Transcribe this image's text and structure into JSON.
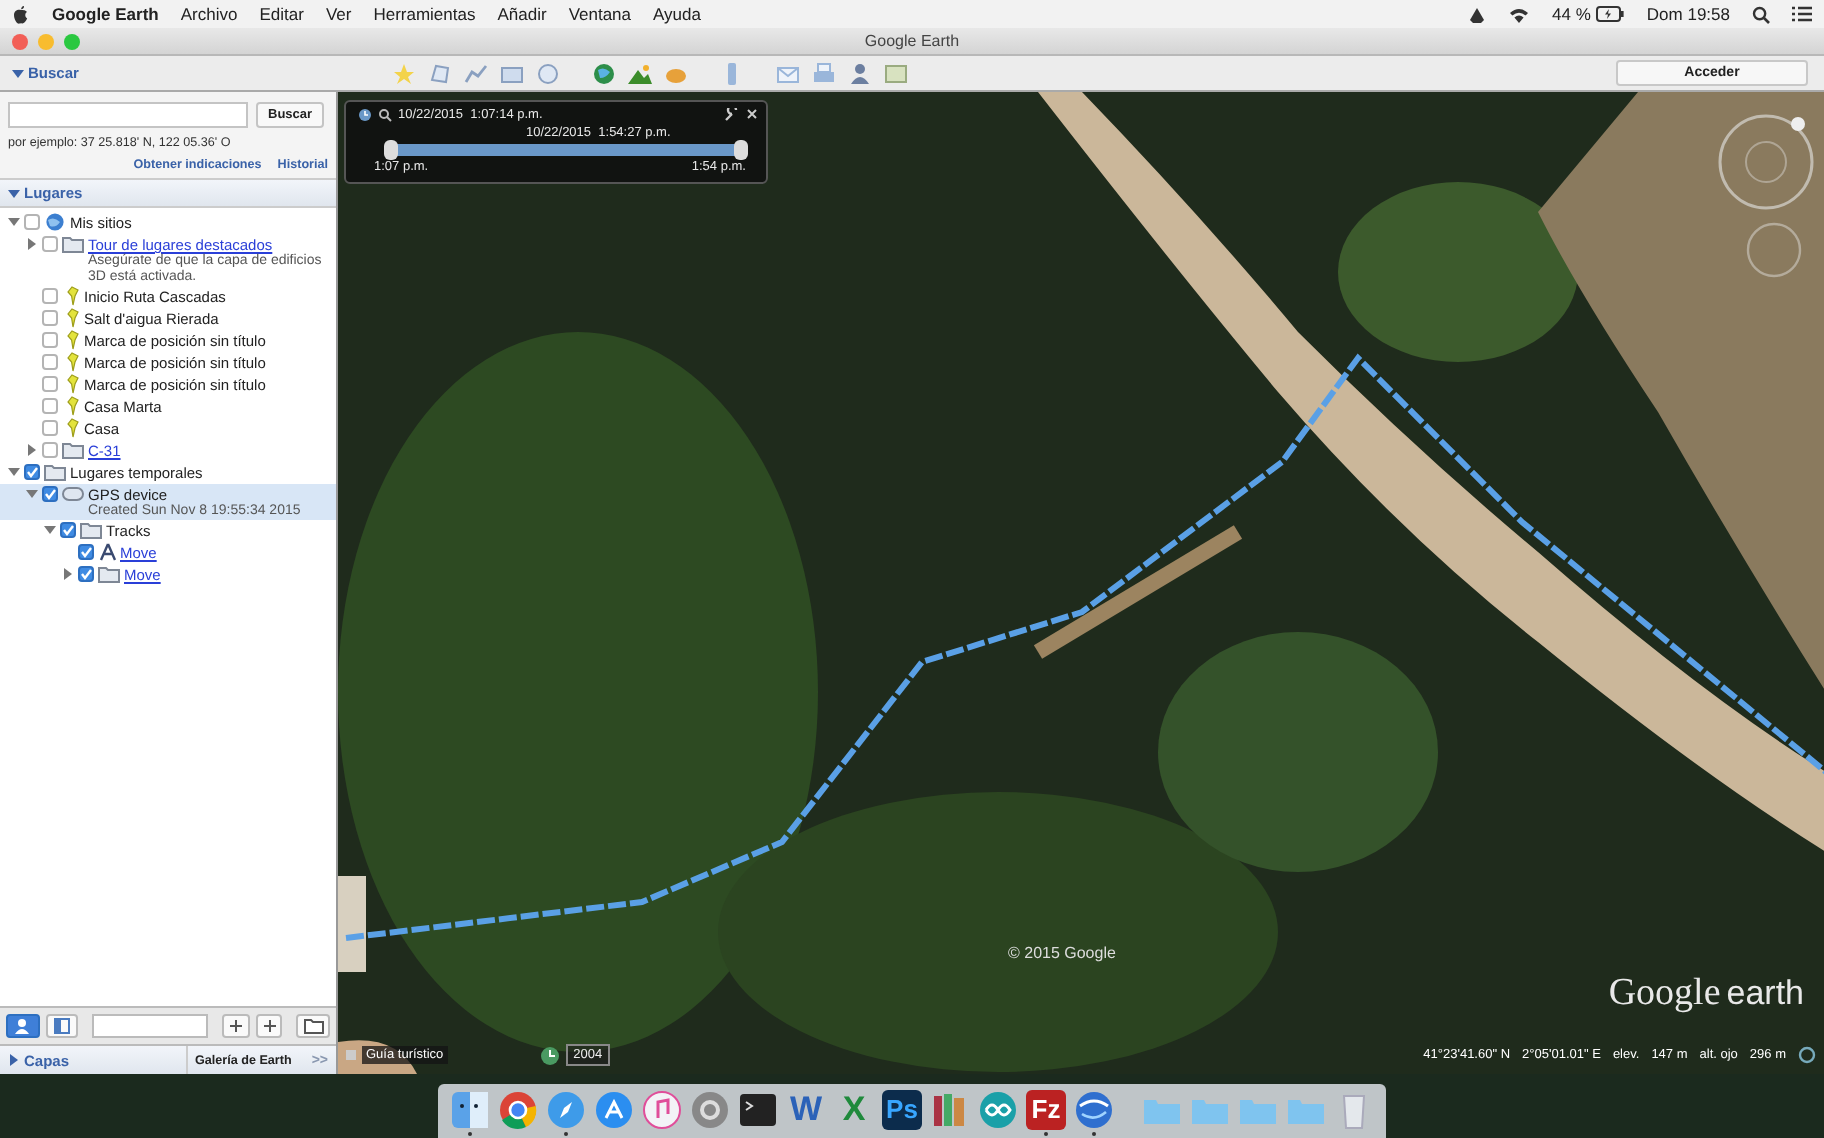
{
  "menu_bar": {
    "app": "Google Earth",
    "items": [
      "Archivo",
      "Editar",
      "Ver",
      "Herramientas",
      "Añadir",
      "Ventana",
      "Ayuda"
    ],
    "battery": "44 %",
    "clock": "Dom 19:58"
  },
  "window": {
    "title": "Google Earth",
    "sign_in": "Acceder"
  },
  "search": {
    "title": "Buscar",
    "expanded": true,
    "button": "Buscar",
    "hint": "por ejemplo: 37 25.818' N, 122 05.36' O",
    "links": [
      "Obtener indicaciones",
      "Historial"
    ]
  },
  "places": {
    "title": "Lugares",
    "expanded": true,
    "items": [
      {
        "label": "Mis sitios",
        "kind": "globe",
        "checked": false,
        "expanded": true,
        "selected": false,
        "children": [
          {
            "label": "Tour de lugares destacados",
            "kind": "folder",
            "link": true,
            "note": "Asegúrate de que la capa de edificios 3D está activada.",
            "checked": false,
            "expanded": false,
            "selected": false
          },
          {
            "label": "Inicio Ruta Cascadas",
            "kind": "pin",
            "checked": false,
            "selected": false
          },
          {
            "label": "Salt d'aigua Rierada",
            "kind": "pin",
            "checked": false,
            "selected": false
          },
          {
            "label": "Marca de posición sin título",
            "kind": "pin",
            "checked": false,
            "selected": false
          },
          {
            "label": "Marca de posición sin título",
            "kind": "pin",
            "checked": false,
            "selected": false
          },
          {
            "label": "Marca de posición sin título",
            "kind": "pin",
            "checked": false,
            "selected": false
          },
          {
            "label": "Casa Marta",
            "kind": "pin",
            "checked": false,
            "selected": false
          },
          {
            "label": "Casa",
            "kind": "pin",
            "checked": false,
            "selected": false
          },
          {
            "label": "C-31",
            "kind": "folder",
            "link": true,
            "checked": false,
            "expanded": false,
            "selected": false
          }
        ]
      },
      {
        "label": "Lugares temporales",
        "kind": "folder",
        "checked": true,
        "expanded": true,
        "selected": false,
        "children": [
          {
            "label": "GPS device",
            "kind": "gps",
            "note": "Created Sun Nov 8 19:55:34 2015",
            "checked": true,
            "expanded": true,
            "selected": true,
            "children": [
              {
                "label": "Tracks",
                "kind": "folder",
                "checked": true,
                "expanded": true,
                "selected": false,
                "children": [
                  {
                    "label": "Move",
                    "kind": "track",
                    "link": true,
                    "checked": true,
                    "selected": false
                  },
                  {
                    "label": "Move",
                    "kind": "folder",
                    "link": true,
                    "checked": true,
                    "expanded": false,
                    "selected": false
                  }
                ]
              }
            ]
          }
        ]
      }
    ]
  },
  "layers": {
    "title": "Capas",
    "expanded": false,
    "gallery": "Galería de Earth",
    "more": ">>"
  },
  "time_slider": {
    "start": "10/22/2015  1:07:14 p.m.",
    "end": "10/22/2015  1:54:27 p.m.",
    "min_label": "1:07 p.m.",
    "max_label": "1:54 p.m."
  },
  "map": {
    "copyright": "© 2015 Google",
    "logo_word_1": "Google",
    "logo_word_2": "earth"
  },
  "status_bar": {
    "tour_guide": "Guía turístico",
    "imagery_year": "2004",
    "latitude": "41°23'41.60\" N",
    "longitude": "2°05'01.01\" E",
    "elev_label": "elev.",
    "elev": "147 m",
    "eye_label": "alt. ojo",
    "eye": "296 m"
  },
  "dock": [
    {
      "kind": "finder",
      "running": true
    },
    {
      "kind": "chrome",
      "running": false
    },
    {
      "kind": "safari",
      "running": true
    },
    {
      "kind": "appstore",
      "running": false
    },
    {
      "kind": "itunes",
      "running": false
    },
    {
      "kind": "prefs",
      "running": false
    },
    {
      "kind": "terminal",
      "running": false
    },
    {
      "kind": "letter",
      "glyph": "W",
      "running": false
    },
    {
      "kind": "letter",
      "glyph": "X",
      "running": false
    },
    {
      "kind": "letter",
      "glyph": "Ps",
      "running": false
    },
    {
      "kind": "books",
      "running": false
    },
    {
      "kind": "arduino",
      "running": false
    },
    {
      "kind": "letter",
      "glyph": "Fz",
      "running": true
    },
    {
      "kind": "earth",
      "running": true
    },
    {
      "kind": "folder",
      "running": false
    },
    {
      "kind": "folder",
      "running": false
    },
    {
      "kind": "folder",
      "running": false
    },
    {
      "kind": "folder",
      "running": false
    },
    {
      "kind": "trash",
      "running": false
    }
  ]
}
